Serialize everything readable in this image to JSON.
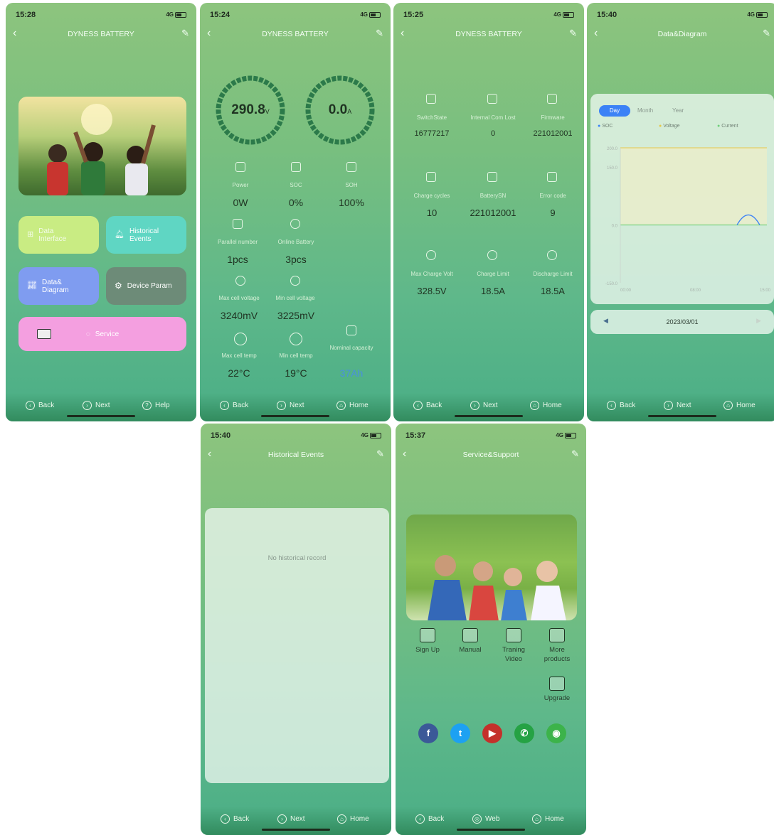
{
  "status": {
    "signal": "4G",
    "times": [
      "15:28",
      "15:24",
      "15:25",
      "15:40",
      "15:40",
      "15:37"
    ]
  },
  "screen1": {
    "title": "DYNESS BATTERY",
    "tiles": {
      "data_interface": "Data Interface",
      "historical_events": "Historical Events",
      "data_diagram": "Data& Diagram",
      "device_param": "Device Param",
      "service": "Service"
    },
    "bottom": {
      "back": "Back",
      "next": "Next",
      "help": "Help"
    }
  },
  "screen2": {
    "title": "DYNESS BATTERY",
    "voltage": {
      "value": "290.8",
      "unit": "V"
    },
    "current": {
      "value": "0.0",
      "unit": "A"
    },
    "metrics": [
      {
        "label": "Power",
        "value": "0W"
      },
      {
        "label": "SOC",
        "value": "0%"
      },
      {
        "label": "SOH",
        "value": "100%"
      },
      {
        "label": "Parallel number",
        "value": "1pcs"
      },
      {
        "label": "Online Battery",
        "value": "3pcs"
      },
      {
        "label": "Max cell voltage",
        "value": "3240mV"
      },
      {
        "label": "Min cell voltage",
        "value": "3225mV"
      },
      {
        "label": "Max cell temp",
        "value": "22°C"
      },
      {
        "label": "Min cell temp",
        "value": "19°C"
      },
      {
        "label": "Nominal capacity",
        "value": "37Ah"
      }
    ],
    "bottom": {
      "back": "Back",
      "next": "Next",
      "home": "Home"
    }
  },
  "screen3": {
    "title": "DYNESS BATTERY",
    "params": [
      {
        "label": "SwitchState",
        "value": "16777217"
      },
      {
        "label": "Internal Com Lost",
        "value": "0"
      },
      {
        "label": "Firmware",
        "value": "221012001"
      },
      {
        "label": "Charge cycles",
        "value": "10"
      },
      {
        "label": "BatterySN",
        "value": "221012001"
      },
      {
        "label": "Error code",
        "value": "9"
      },
      {
        "label": "Max Charge Volt",
        "value": "328.5V"
      },
      {
        "label": "Charge Limit",
        "value": "18.5A"
      },
      {
        "label": "Discharge Limit",
        "value": "18.5A"
      }
    ],
    "bottom": {
      "back": "Back",
      "next": "Next",
      "home": "Home"
    }
  },
  "screen4": {
    "title": "Data&Diagram",
    "tabs": [
      "Day",
      "Month",
      "Year"
    ],
    "legend": [
      "SOC",
      "Voltage",
      "Current"
    ],
    "yticks": [
      "200.0",
      "150.0",
      "0.0",
      "-150.0"
    ],
    "xticks": [
      "00:00",
      "08:00",
      "15:00"
    ],
    "date": "2023/03/01",
    "bottom": {
      "back": "Back",
      "next": "Next",
      "home": "Home"
    }
  },
  "chart_data": {
    "type": "line",
    "categories": [
      "00:00",
      "08:00",
      "15:00"
    ],
    "series": [
      {
        "name": "Voltage",
        "values": [
          200,
          200,
          200
        ]
      },
      {
        "name": "Current",
        "values": [
          0,
          0,
          0
        ]
      },
      {
        "name": "SOC",
        "values": [
          0,
          0,
          30
        ]
      }
    ],
    "ylim": [
      -150,
      200
    ]
  },
  "screen5": {
    "title": "Historical Events",
    "empty": "No historical record",
    "bottom": {
      "back": "Back",
      "next": "Next",
      "home": "Home"
    }
  },
  "screen6": {
    "title": "Service&Support",
    "actions": [
      {
        "label": "Sign Up"
      },
      {
        "label": "Manual"
      },
      {
        "label": "Traning Video"
      },
      {
        "label": "More products"
      },
      {
        "label": "Upgrade"
      }
    ],
    "social": [
      "facebook-icon",
      "twitter-icon",
      "youtube-icon",
      "whatsapp-icon",
      "wechat-icon"
    ],
    "bottom": {
      "back": "Back",
      "web": "Web",
      "home": "Home"
    }
  },
  "colors": {
    "lime_tile": "#c9ec83",
    "teal_tile": "#5fd6c3",
    "blue_tile": "#7f9cf0",
    "gray_tile": "#6d8b78",
    "pink_tile": "#f49fe0",
    "ring": "#2c7a4a",
    "chart_blue": "#3b82f6"
  }
}
